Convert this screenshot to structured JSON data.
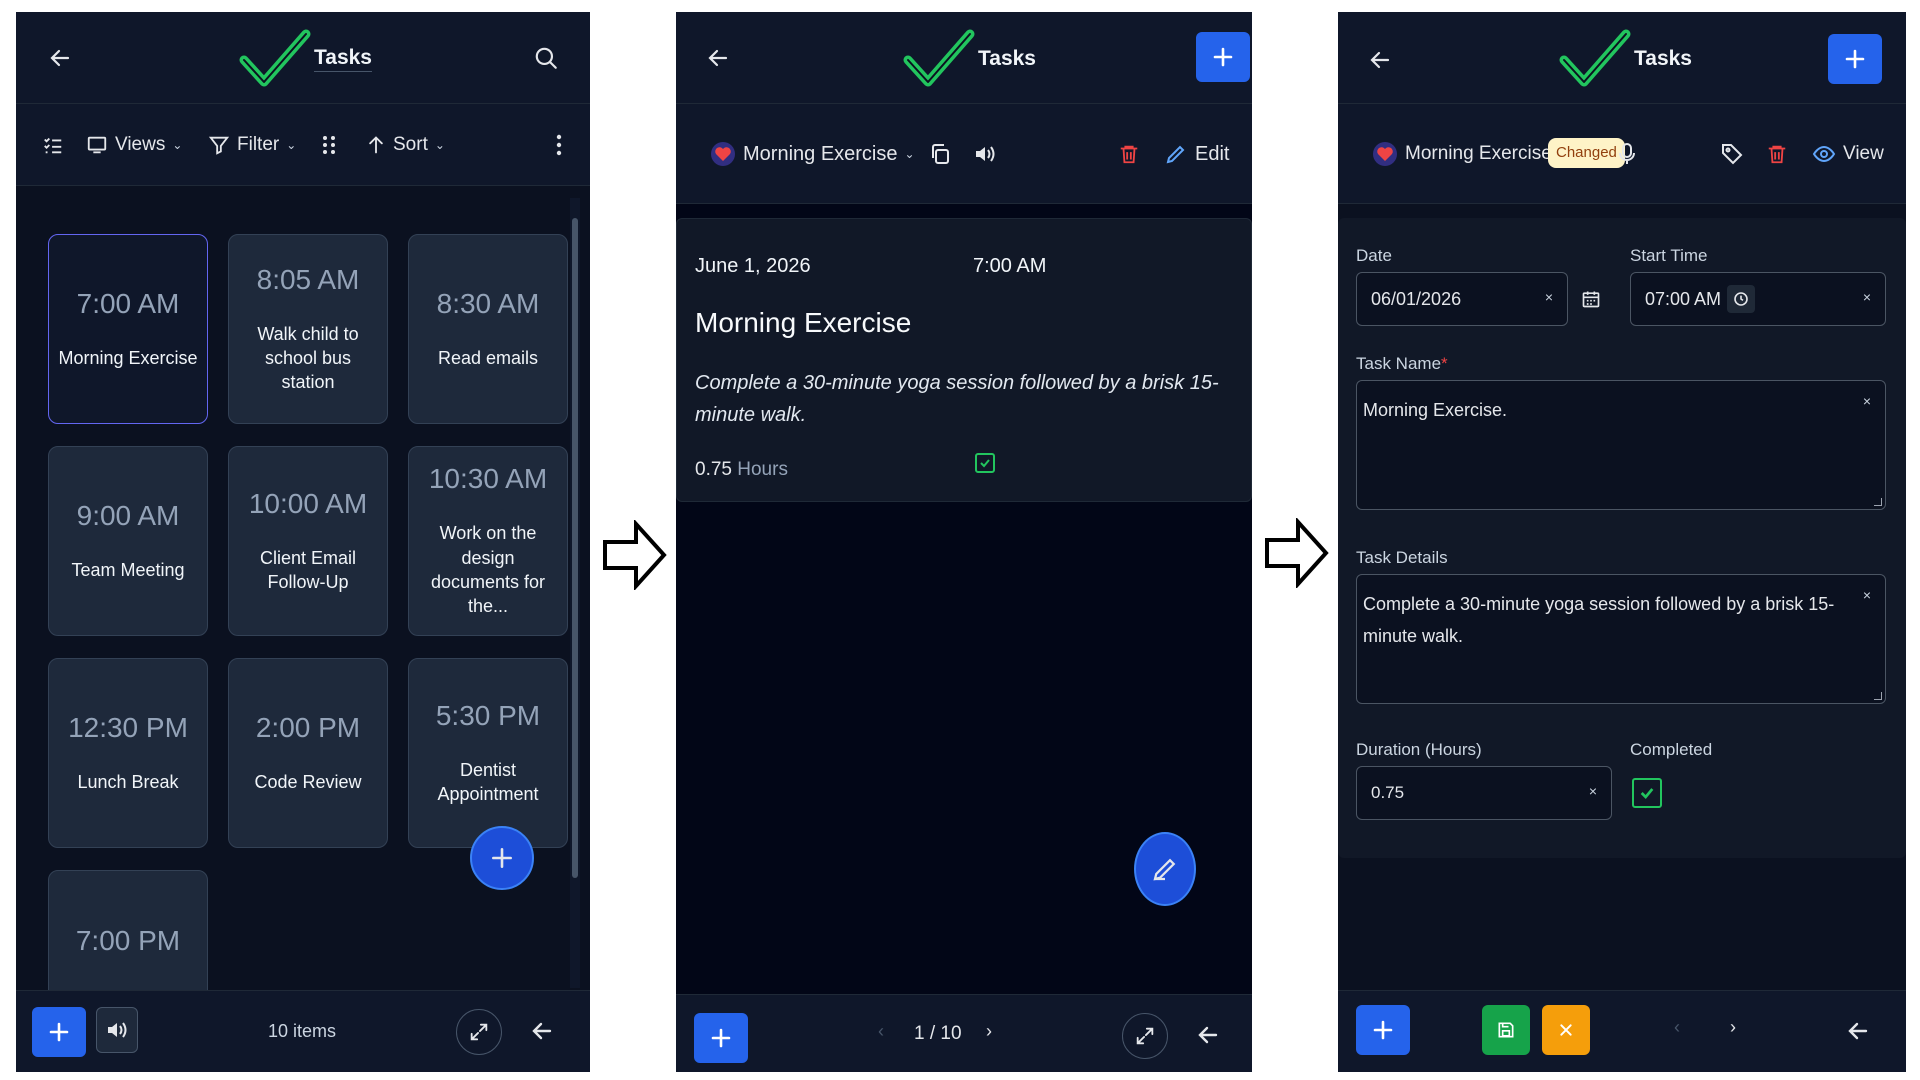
{
  "app": {
    "title": "Tasks",
    "colors": {
      "bg": "#0b1120",
      "accent": "#2563eb",
      "check": "#22c55e",
      "danger": "#ef4444",
      "save": "#16a34a",
      "cancel": "#f59e0b"
    }
  },
  "list_view": {
    "toolbar": {
      "views": "Views",
      "filter": "Filter",
      "sort": "Sort"
    },
    "cards": [
      {
        "time": "7:00 AM",
        "title": "Morning Exercise",
        "selected": true
      },
      {
        "time": "8:05 AM",
        "title": "Walk child to school bus station"
      },
      {
        "time": "8:30 AM",
        "title": "Read emails"
      },
      {
        "time": "9:00 AM",
        "title": "Team Meeting"
      },
      {
        "time": "10:00 AM",
        "title": "Client Email Follow-Up"
      },
      {
        "time": "10:30 AM",
        "title": "Work on the design documents for the..."
      },
      {
        "time": "12:30 PM",
        "title": "Lunch Break"
      },
      {
        "time": "2:00 PM",
        "title": "Code Review"
      },
      {
        "time": "5:30 PM",
        "title": "Dentist Appointment"
      },
      {
        "time": "7:00 PM",
        "title": ""
      }
    ],
    "footer": {
      "count": "10 items"
    }
  },
  "detail_view": {
    "task_name": "Morning Exercise",
    "edit_label": "Edit",
    "date": "June 1, 2026",
    "time": "7:00 AM",
    "title": "Morning Exercise",
    "details": "Complete a 30-minute yoga session followed by a brisk 15-minute walk.",
    "duration": "0.75",
    "duration_unit": "Hours",
    "completed": true,
    "pager": "1 / 10"
  },
  "edit_view": {
    "task_name": "Morning Exercise.",
    "changed_badge": "Changed",
    "view_label": "View",
    "labels": {
      "date": "Date",
      "start_time": "Start Time",
      "task_name": "Task Name",
      "required_mark": "*",
      "task_details": "Task Details",
      "duration": "Duration (Hours)",
      "completed": "Completed"
    },
    "values": {
      "date": "06/01/2026",
      "start_time": "07:00 AM",
      "task_name": "Morning Exercise.",
      "task_details": "Complete a 30-minute yoga session followed by a brisk 15-minute walk.",
      "duration": "0.75"
    },
    "clear_glyph": "×",
    "completed": true
  }
}
